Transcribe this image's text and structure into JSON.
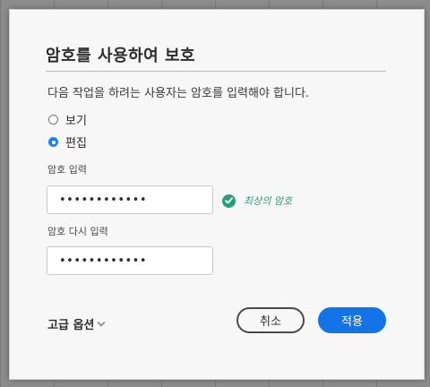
{
  "dialog": {
    "title": "암호를 사용하여 보호",
    "description": "다음 작업을 하려는 사용자는 암호를 입력해야 합니다.",
    "options": [
      {
        "label": "보기",
        "checked": false
      },
      {
        "label": "편집",
        "checked": true
      }
    ],
    "password": {
      "label": "암호 입력",
      "value": "••••••••••••",
      "strength": "최상의 암호"
    },
    "confirm_password": {
      "label": "암호 다시 입력",
      "value": "••••••••••••"
    },
    "advanced_label": "고급 옵션",
    "cancel_label": "취소",
    "apply_label": "적용"
  },
  "colors": {
    "accent": "#1473e6",
    "success": "#2d9d78"
  }
}
